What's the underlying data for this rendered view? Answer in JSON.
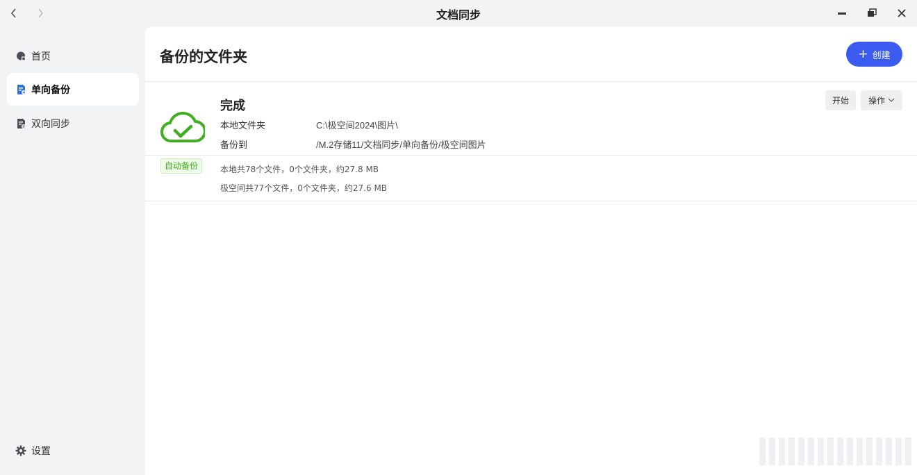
{
  "window": {
    "title": "文档同步"
  },
  "sidebar": {
    "items": [
      {
        "label": "首页",
        "icon": "home-icon",
        "active": false
      },
      {
        "label": "单向备份",
        "icon": "backup-doc-icon",
        "active": true
      },
      {
        "label": "双向同步",
        "icon": "sync-doc-icon",
        "active": false
      }
    ],
    "settings_label": "设置"
  },
  "main": {
    "title": "备份的文件夹",
    "create_label": "创建",
    "accent_color": "#3b5bf0"
  },
  "task": {
    "status": "完成",
    "icon": "cloud-check-icon",
    "status_color": "#3fae1f",
    "badge": "自动备份",
    "local_folder_label": "本地文件夹",
    "local_folder_value": "C:\\极空间2024\\图片\\",
    "backup_to_label": "备份到",
    "backup_to_value": "/M.2存储11/文档同步/单向备份/极空间图片",
    "local_stats": "本地共78个文件，0个文件夹，约27.8 MB",
    "remote_stats": "极空间共77个文件，0个文件夹，约27.6 MB",
    "start_label": "开始",
    "ops_label": "操作"
  }
}
